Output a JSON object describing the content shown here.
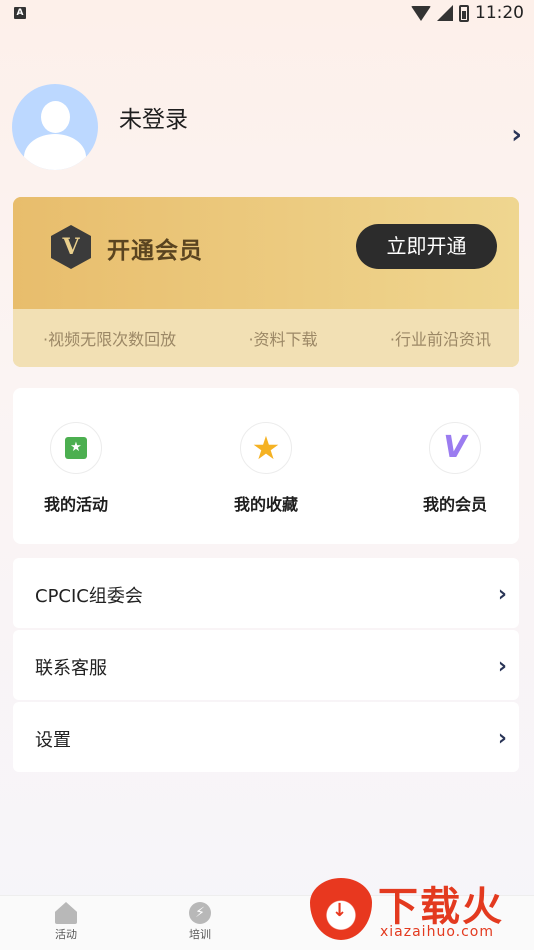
{
  "status_bar": {
    "left_icon": "A",
    "time": "11:20"
  },
  "profile": {
    "name": "未登录"
  },
  "vip": {
    "badge_letter": "V",
    "title": "开通会员",
    "button": "立即开通",
    "features": [
      "·视频无限次数回放",
      "·资料下载",
      "·行业前沿资讯"
    ]
  },
  "shortcuts": [
    {
      "label": "我的活动",
      "icon": "activity-icon"
    },
    {
      "label": "我的收藏",
      "icon": "star-icon"
    },
    {
      "label": "我的会员",
      "icon": "vip-icon"
    }
  ],
  "menu": [
    {
      "label": "CPCIC组委会"
    },
    {
      "label": "联系客服"
    },
    {
      "label": "设置"
    }
  ],
  "bottom_nav": [
    {
      "label": "活动",
      "icon": "home-icon"
    },
    {
      "label": "培训",
      "icon": "bulb-icon"
    }
  ],
  "watermark": {
    "text": "下载火",
    "url": "xiazaihuo.com"
  }
}
